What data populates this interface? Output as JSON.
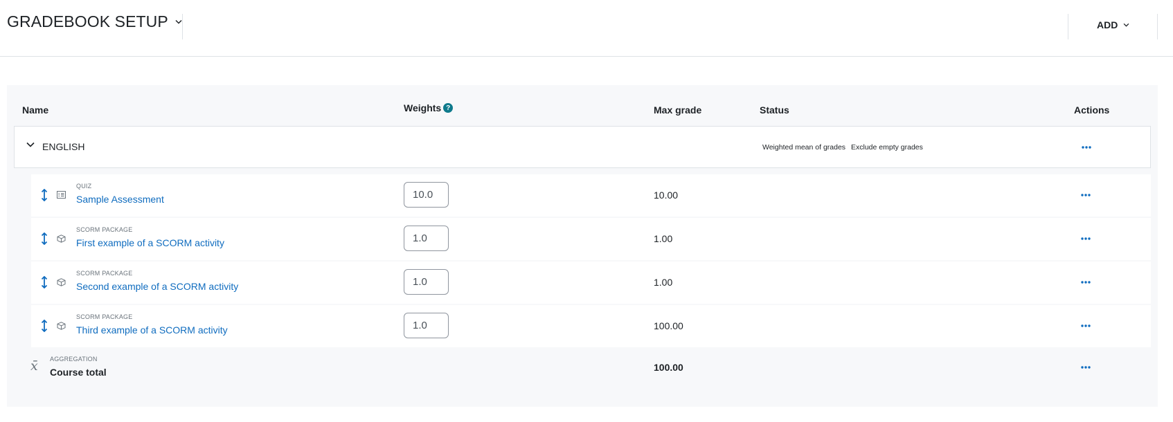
{
  "header": {
    "title": "GRADEBOOK SETUP",
    "add_label": "ADD"
  },
  "columns": {
    "name": "Name",
    "weights": "Weights",
    "weights_help": "?",
    "max_grade": "Max grade",
    "status": "Status",
    "actions": "Actions"
  },
  "category": {
    "name": "ENGLISH",
    "status_badges": [
      "Weighted mean of grades",
      "Exclude empty grades"
    ]
  },
  "items": [
    {
      "type": "QUIZ",
      "name": "Sample Assessment",
      "weight": "10.0",
      "max_grade": "10.00",
      "icon": "quiz-icon"
    },
    {
      "type": "SCORM PACKAGE",
      "name": "First example of a SCORM activity",
      "weight": "1.0",
      "max_grade": "1.00",
      "icon": "scorm-package-icon"
    },
    {
      "type": "SCORM PACKAGE",
      "name": "Second example of a SCORM activity",
      "weight": "1.0",
      "max_grade": "1.00",
      "icon": "scorm-package-icon"
    },
    {
      "type": "SCORM PACKAGE",
      "name": "Third example of a SCORM activity",
      "weight": "1.0",
      "max_grade": "100.00",
      "icon": "scorm-package-icon"
    }
  ],
  "total": {
    "symbol": "x̄",
    "type": "AGGREGATION",
    "name": "Course total",
    "max_grade": "100.00"
  },
  "colors": {
    "link": "#0f6cbf",
    "panel_bg": "#f7f8fa",
    "help_badge": "#0e7a8c"
  }
}
